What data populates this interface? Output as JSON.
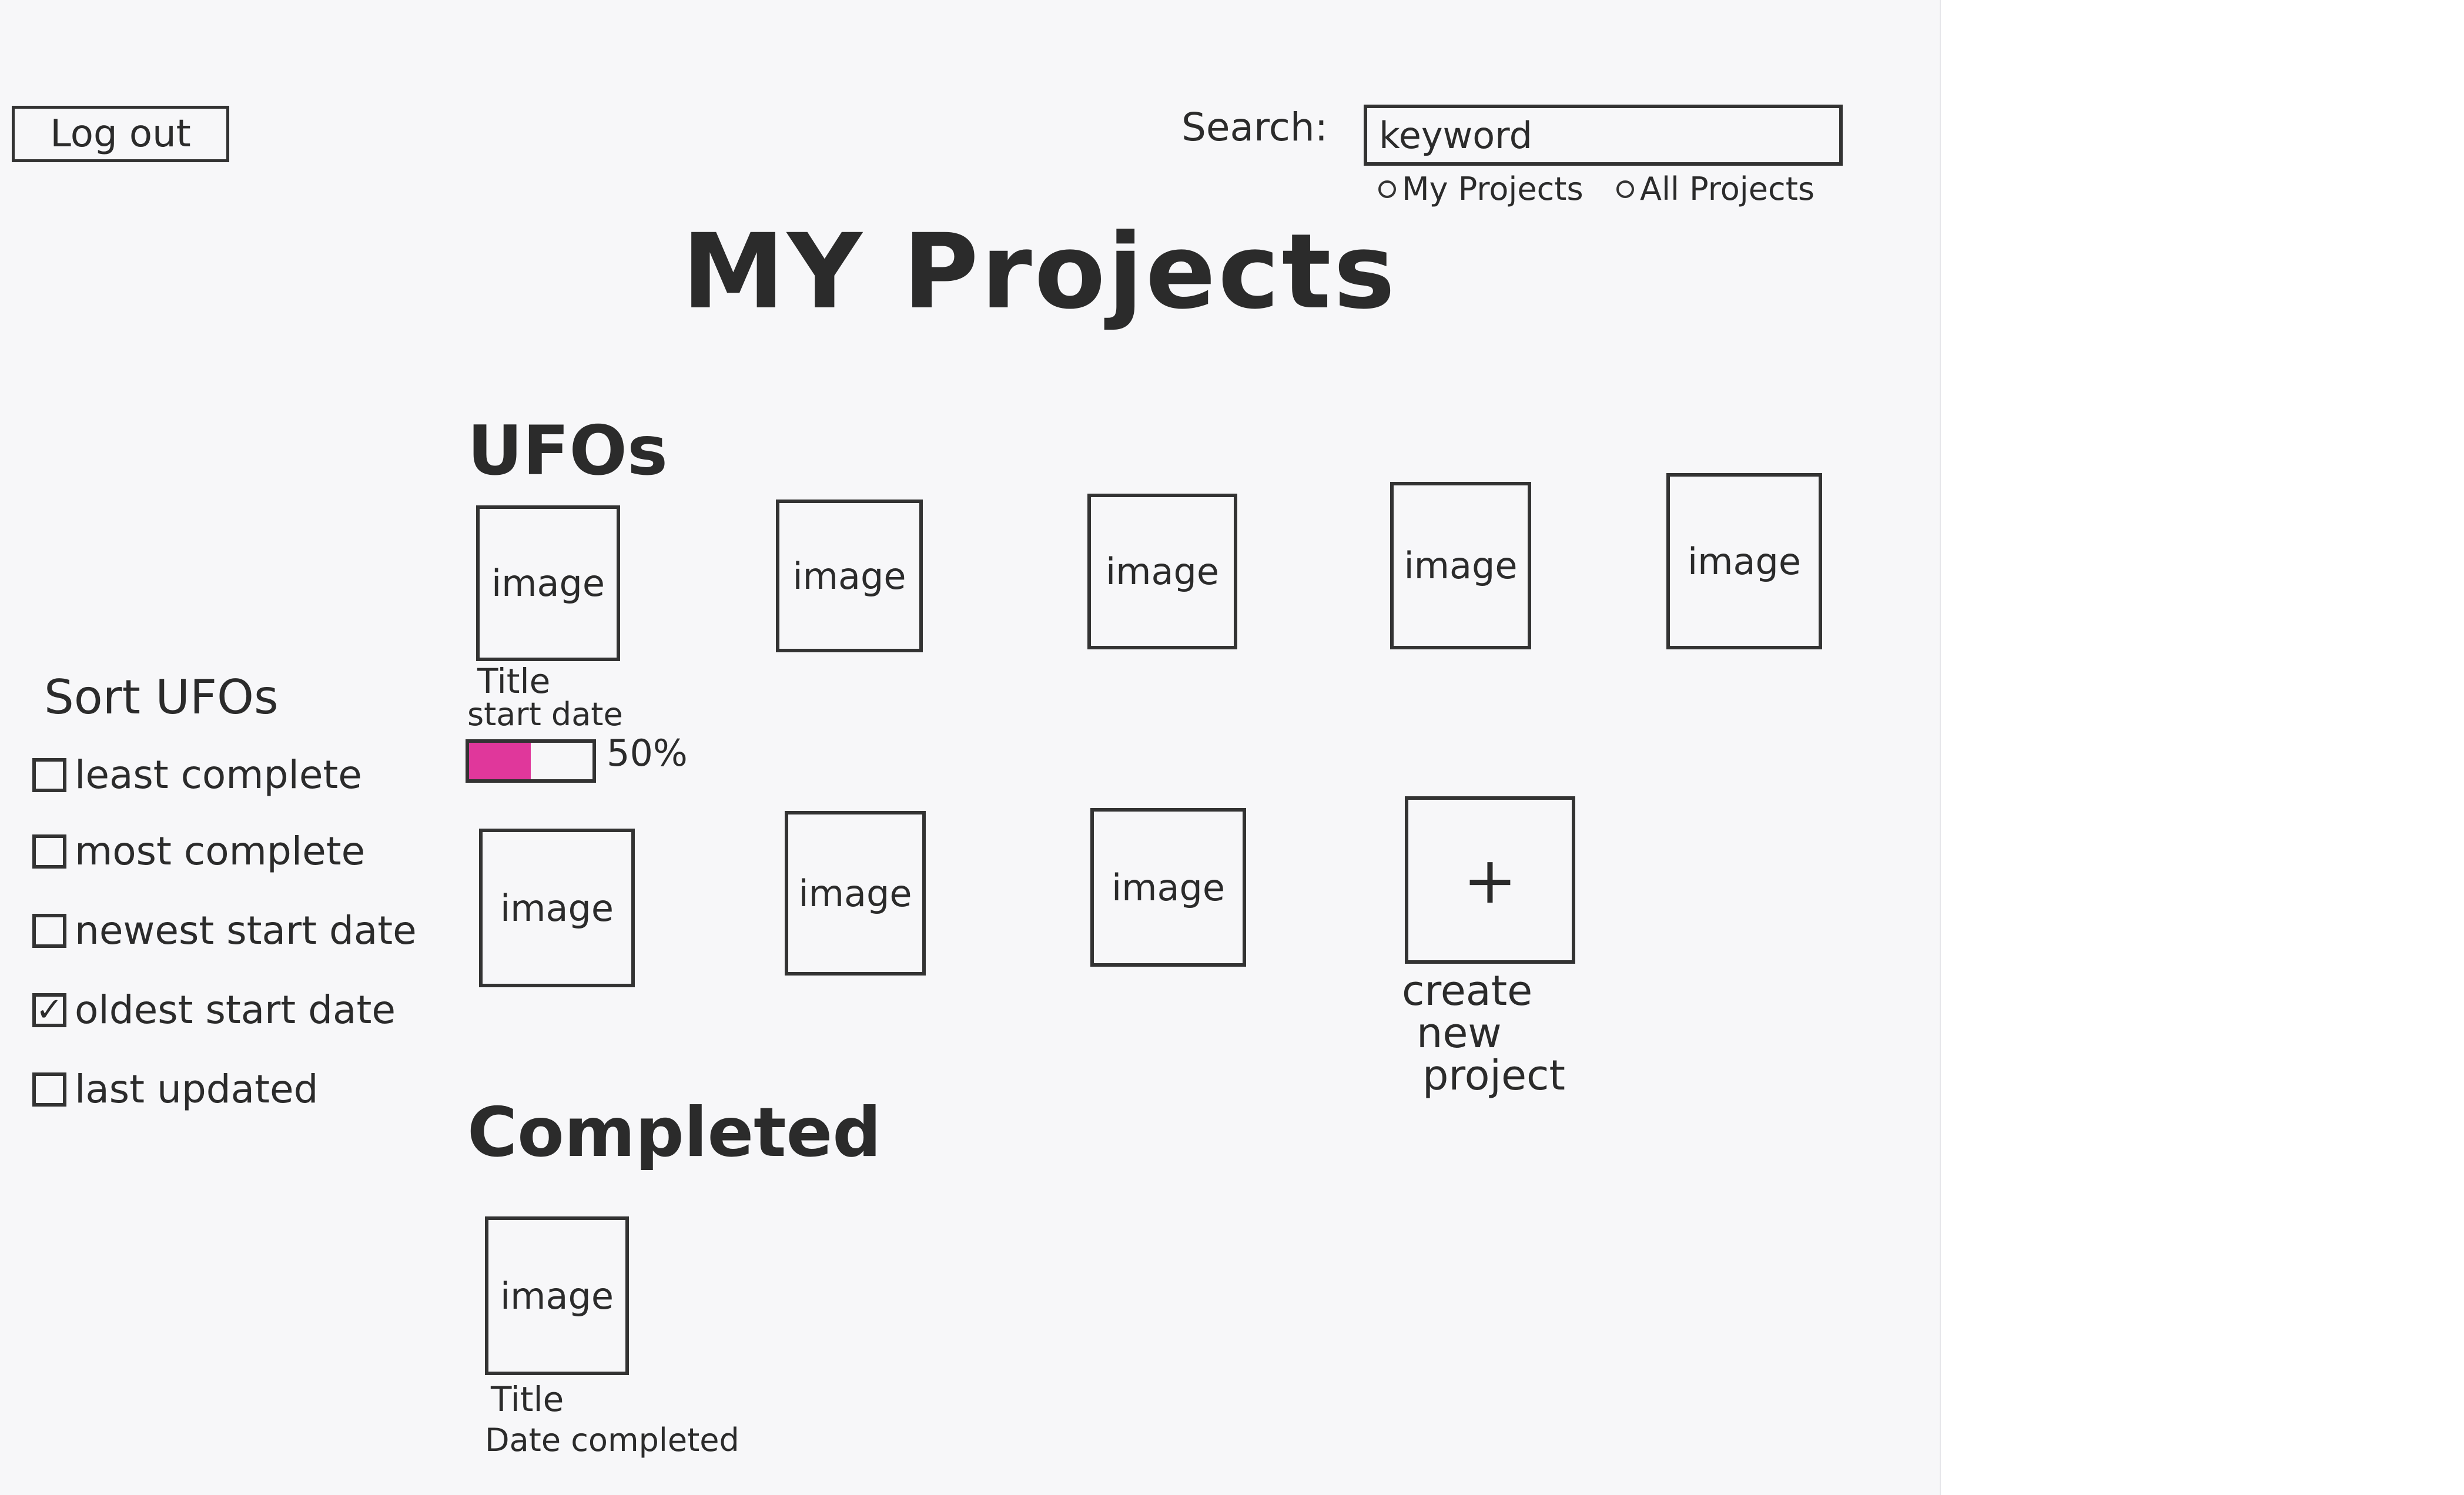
{
  "header": {
    "logout_label": "Log out",
    "search_label": "Search:",
    "search_value": "keyword",
    "search_scopes": [
      "My Projects",
      "All Projects"
    ]
  },
  "page_title": "MY Projects",
  "ufos_section": {
    "title": "UFOs",
    "tile_label": "image",
    "first_card": {
      "title": "Title",
      "subtitle": "start date",
      "progress_percent": 50,
      "progress_label": "50%"
    },
    "create_button_icon": "plus-icon",
    "create_label_lines": [
      "create",
      "new",
      "project"
    ]
  },
  "sort": {
    "title": "Sort UFOs",
    "options": [
      {
        "label": "least complete",
        "checked": false
      },
      {
        "label": "most complete",
        "checked": false
      },
      {
        "label": "newest start date",
        "checked": false
      },
      {
        "label": "oldest start date",
        "checked": true
      },
      {
        "label": "last updated",
        "checked": false
      }
    ]
  },
  "completed_section": {
    "title": "Completed",
    "tile_label": "image",
    "card": {
      "title": "Title",
      "subtitle": "Date completed"
    }
  },
  "colors": {
    "progress_fill": "#e0379b",
    "ink": "#2b2b2b",
    "paper": "#f7f7f9"
  }
}
